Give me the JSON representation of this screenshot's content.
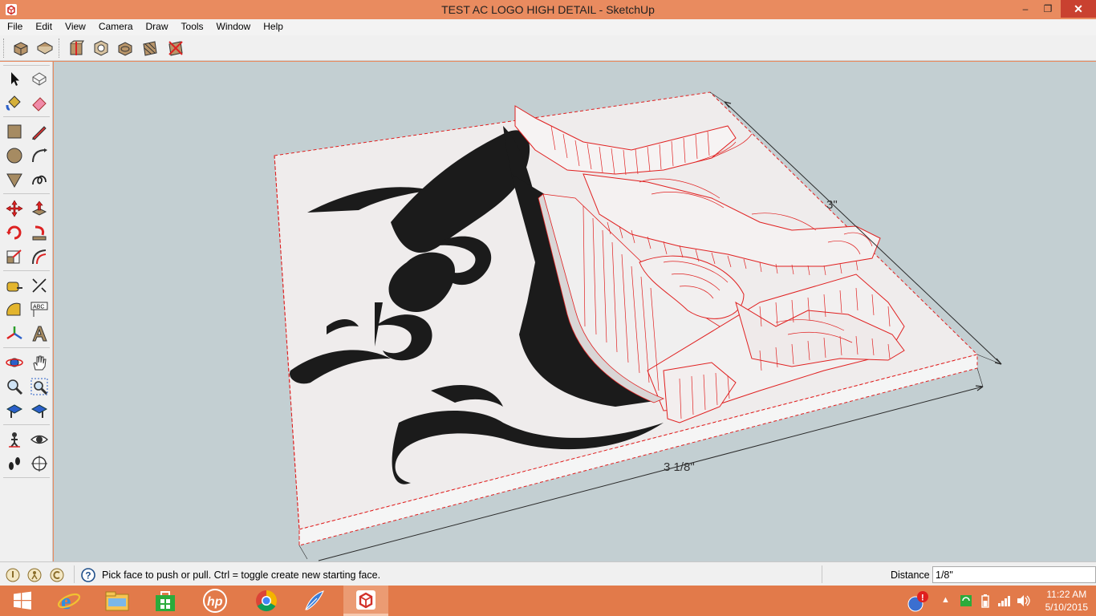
{
  "window": {
    "title": "TEST AC LOGO HIGH DETAIL - SketchUp",
    "minimize_glyph": "–",
    "maximize_glyph": "❐",
    "close_glyph": "✕"
  },
  "menu": {
    "items": [
      "File",
      "Edit",
      "View",
      "Camera",
      "Draw",
      "Tools",
      "Window",
      "Help"
    ]
  },
  "toolbar": {
    "views": [
      "iso-view-icon",
      "top-view-icon",
      "front-view-icon",
      "right-view-icon",
      "back-view-icon",
      "left-view-icon"
    ]
  },
  "tools": {
    "rows": [
      [
        "select-arrow-icon",
        "component-icon"
      ],
      [
        "paint-bucket-icon",
        "eraser-icon"
      ],
      [
        "rectangle-icon",
        "pencil-line-icon"
      ],
      [
        "circle-icon",
        "arc-icon"
      ],
      [
        "polygon-icon",
        "freehand-icon"
      ],
      [
        "move-icon",
        "push-pull-icon"
      ],
      [
        "rotate-icon",
        "follow-me-icon"
      ],
      [
        "scale-icon",
        "offset-icon"
      ],
      [
        "tape-measure-icon",
        "dimension-icon"
      ],
      [
        "protractor-icon",
        "text-label-icon"
      ],
      [
        "axes-icon",
        "3d-text-icon"
      ],
      [
        "orbit-icon",
        "pan-hand-icon"
      ],
      [
        "zoom-icon",
        "zoom-window-icon"
      ],
      [
        "previous-view-icon",
        "zoom-extents-icon"
      ],
      [
        "position-camera-icon",
        "look-around-icon"
      ],
      [
        "walk-icon",
        "section-plane-icon"
      ]
    ]
  },
  "viewport": {
    "dimension_depth": "3\"",
    "dimension_width": "3 1/8\""
  },
  "status": {
    "message": "Pick face to push or pull.  Ctrl = toggle create new starting face.",
    "help_glyph": "?",
    "vcb_label": "Distance",
    "vcb_value": "1/8\""
  },
  "tray": {
    "time": "11:22 AM",
    "date": "5/10/2015",
    "arrow_glyph": "▲"
  },
  "colors": {
    "titlebar": "#e98b5f",
    "taskbar": "#e27a4a",
    "viewport_bg": "#c3cfd2",
    "edge_red": "#e02020"
  }
}
